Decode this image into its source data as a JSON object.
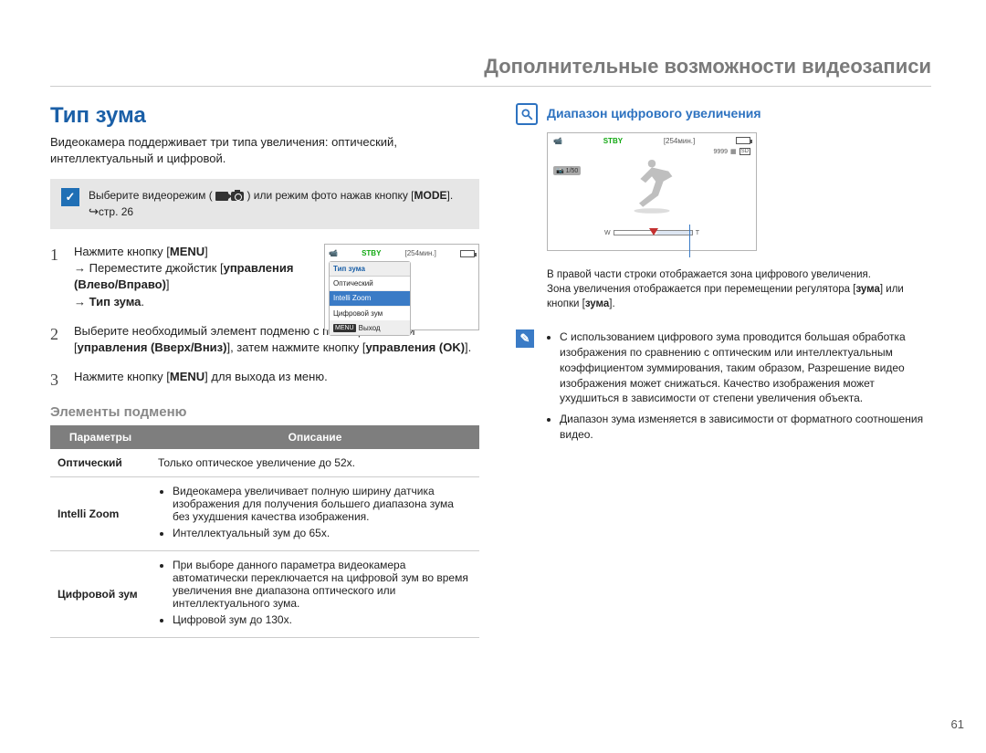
{
  "header": "Дополнительные возможности видеозаписи",
  "section_title": "Тип зума",
  "intro": "Видеокамера поддерживает три типа увеличения: оптический, интеллектуальный и цифровой.",
  "note": {
    "pre": "Выберите видеорежим (",
    "mid": ") или режим фото нажав кнопку [",
    "mode": "MODE",
    "end": "]. ",
    "ref": "стр. 26"
  },
  "steps": {
    "s1": {
      "num": "1",
      "l1": "Нажмите кнопку [",
      "menu": "MENU",
      "l2": "] ",
      "arrow": "→",
      "l3": " Переместите джойстик [",
      "ctrl": "управления (Влево/Вправо)",
      "l4": "] ",
      "l5": "Тип зума",
      "l6": "."
    },
    "s2": {
      "num": "2",
      "l1": "Выберите необходимый элемент подменю с помощью кнопки [",
      "ctrl": "управления (Вверх/Вниз)",
      "l2": "], затем нажмите кнопку [",
      "ok": "управления (OK)",
      "l3": "]."
    },
    "s3": {
      "num": "3",
      "l1": "Нажмите кнопку [",
      "menu": "MENU",
      "l2": "] для выхода из меню."
    }
  },
  "cam_screen": {
    "stby": "STBY",
    "time": "[254мин.]",
    "menu_title": "Тип зума",
    "items": [
      "Оптический",
      "Intelli Zoom",
      "Цифровой зум"
    ],
    "selected_index": 1,
    "menu_btn": "MENU",
    "exit": "Выход"
  },
  "sub_title": "Элементы подменю",
  "table": {
    "h1": "Параметры",
    "h2": "Описание",
    "rows": [
      {
        "name": "Оптический",
        "plain": "Только оптическое увеличение до 52x."
      },
      {
        "name": "Intelli Zoom",
        "bullets": [
          "Видеокамера увеличивает полную ширину датчика изображения для получения большего диапазона зума без ухудшения качества изображения.",
          "Интеллектуальный зум до 65x."
        ]
      },
      {
        "name": "Цифровой зум",
        "bullets": [
          "При выборе данного параметра видеокамера автоматически переключается на цифровой зум во время увеличения вне диапазона оптического или интеллектуального зума.",
          "Цифровой зум до 130x."
        ]
      }
    ]
  },
  "zoom": {
    "title": "Диапазон цифрового увеличения",
    "stby": "STBY",
    "time": "[254мин.]",
    "count": "9999",
    "sd": "SD",
    "shutter": "1/50",
    "w": "W",
    "t": "T",
    "note1": "В правой части строки отображается зона цифрового увеличения.",
    "note2": "Зона увеличения отображается при перемещении регулятора [",
    "zoom_word": "зума",
    "note2b": "] или кнопки [",
    "note2c": "зума",
    "note2d": "]."
  },
  "info": {
    "bullets": [
      "С использованием цифрового зума проводится большая обработка изображения по сравнению с оптическим или интеллектуальным коэффициентом зуммирования, таким образом, Разрешение видео изображения может снижаться. Качество изображения может ухудшиться в зависимости от степени увеличения объекта.",
      "Диапазон зума изменяется в зависимости от форматного соотношения видео."
    ]
  },
  "page_num": "61"
}
